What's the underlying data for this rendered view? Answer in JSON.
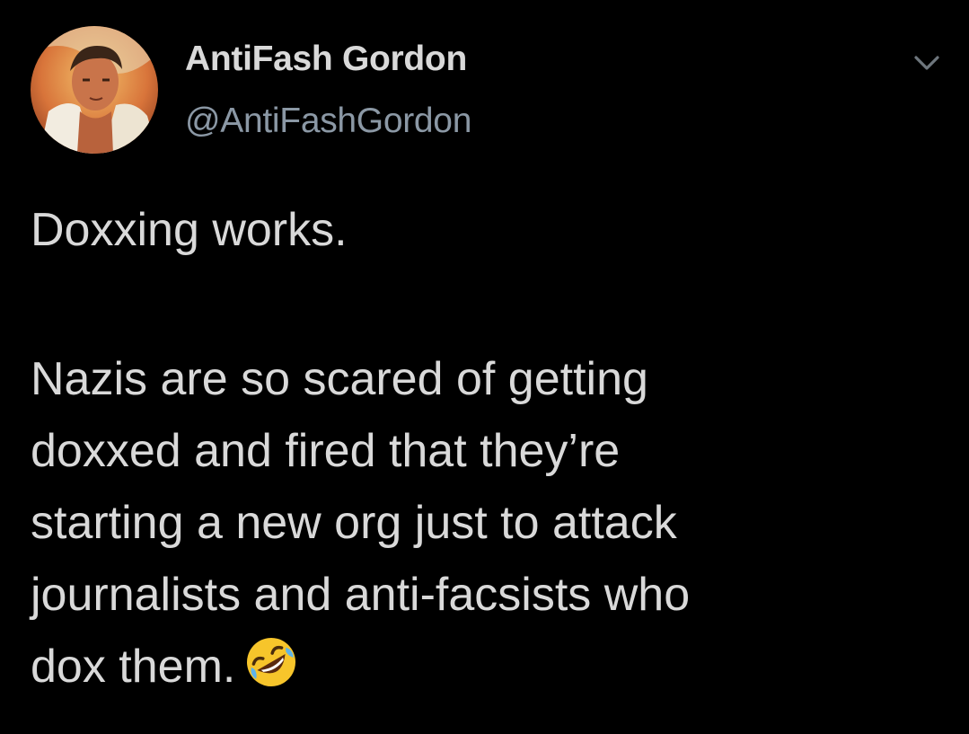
{
  "user": {
    "display_name": "AntiFash Gordon",
    "handle": "@AntiFashGordon"
  },
  "tweet": {
    "lines": [
      "Doxxing works.",
      "Nazis are so scared of getting",
      "doxxed and fired that they’re",
      "starting a new org just to attack",
      "journalists and anti-facsists who",
      "dox them."
    ],
    "emoji": "rolling-on-floor-laughing-emoji"
  },
  "icons": {
    "menu": "chevron-down-icon"
  },
  "colors": {
    "background": "#000000",
    "text": "#d9d9d9",
    "handle": "#8b98a5"
  }
}
